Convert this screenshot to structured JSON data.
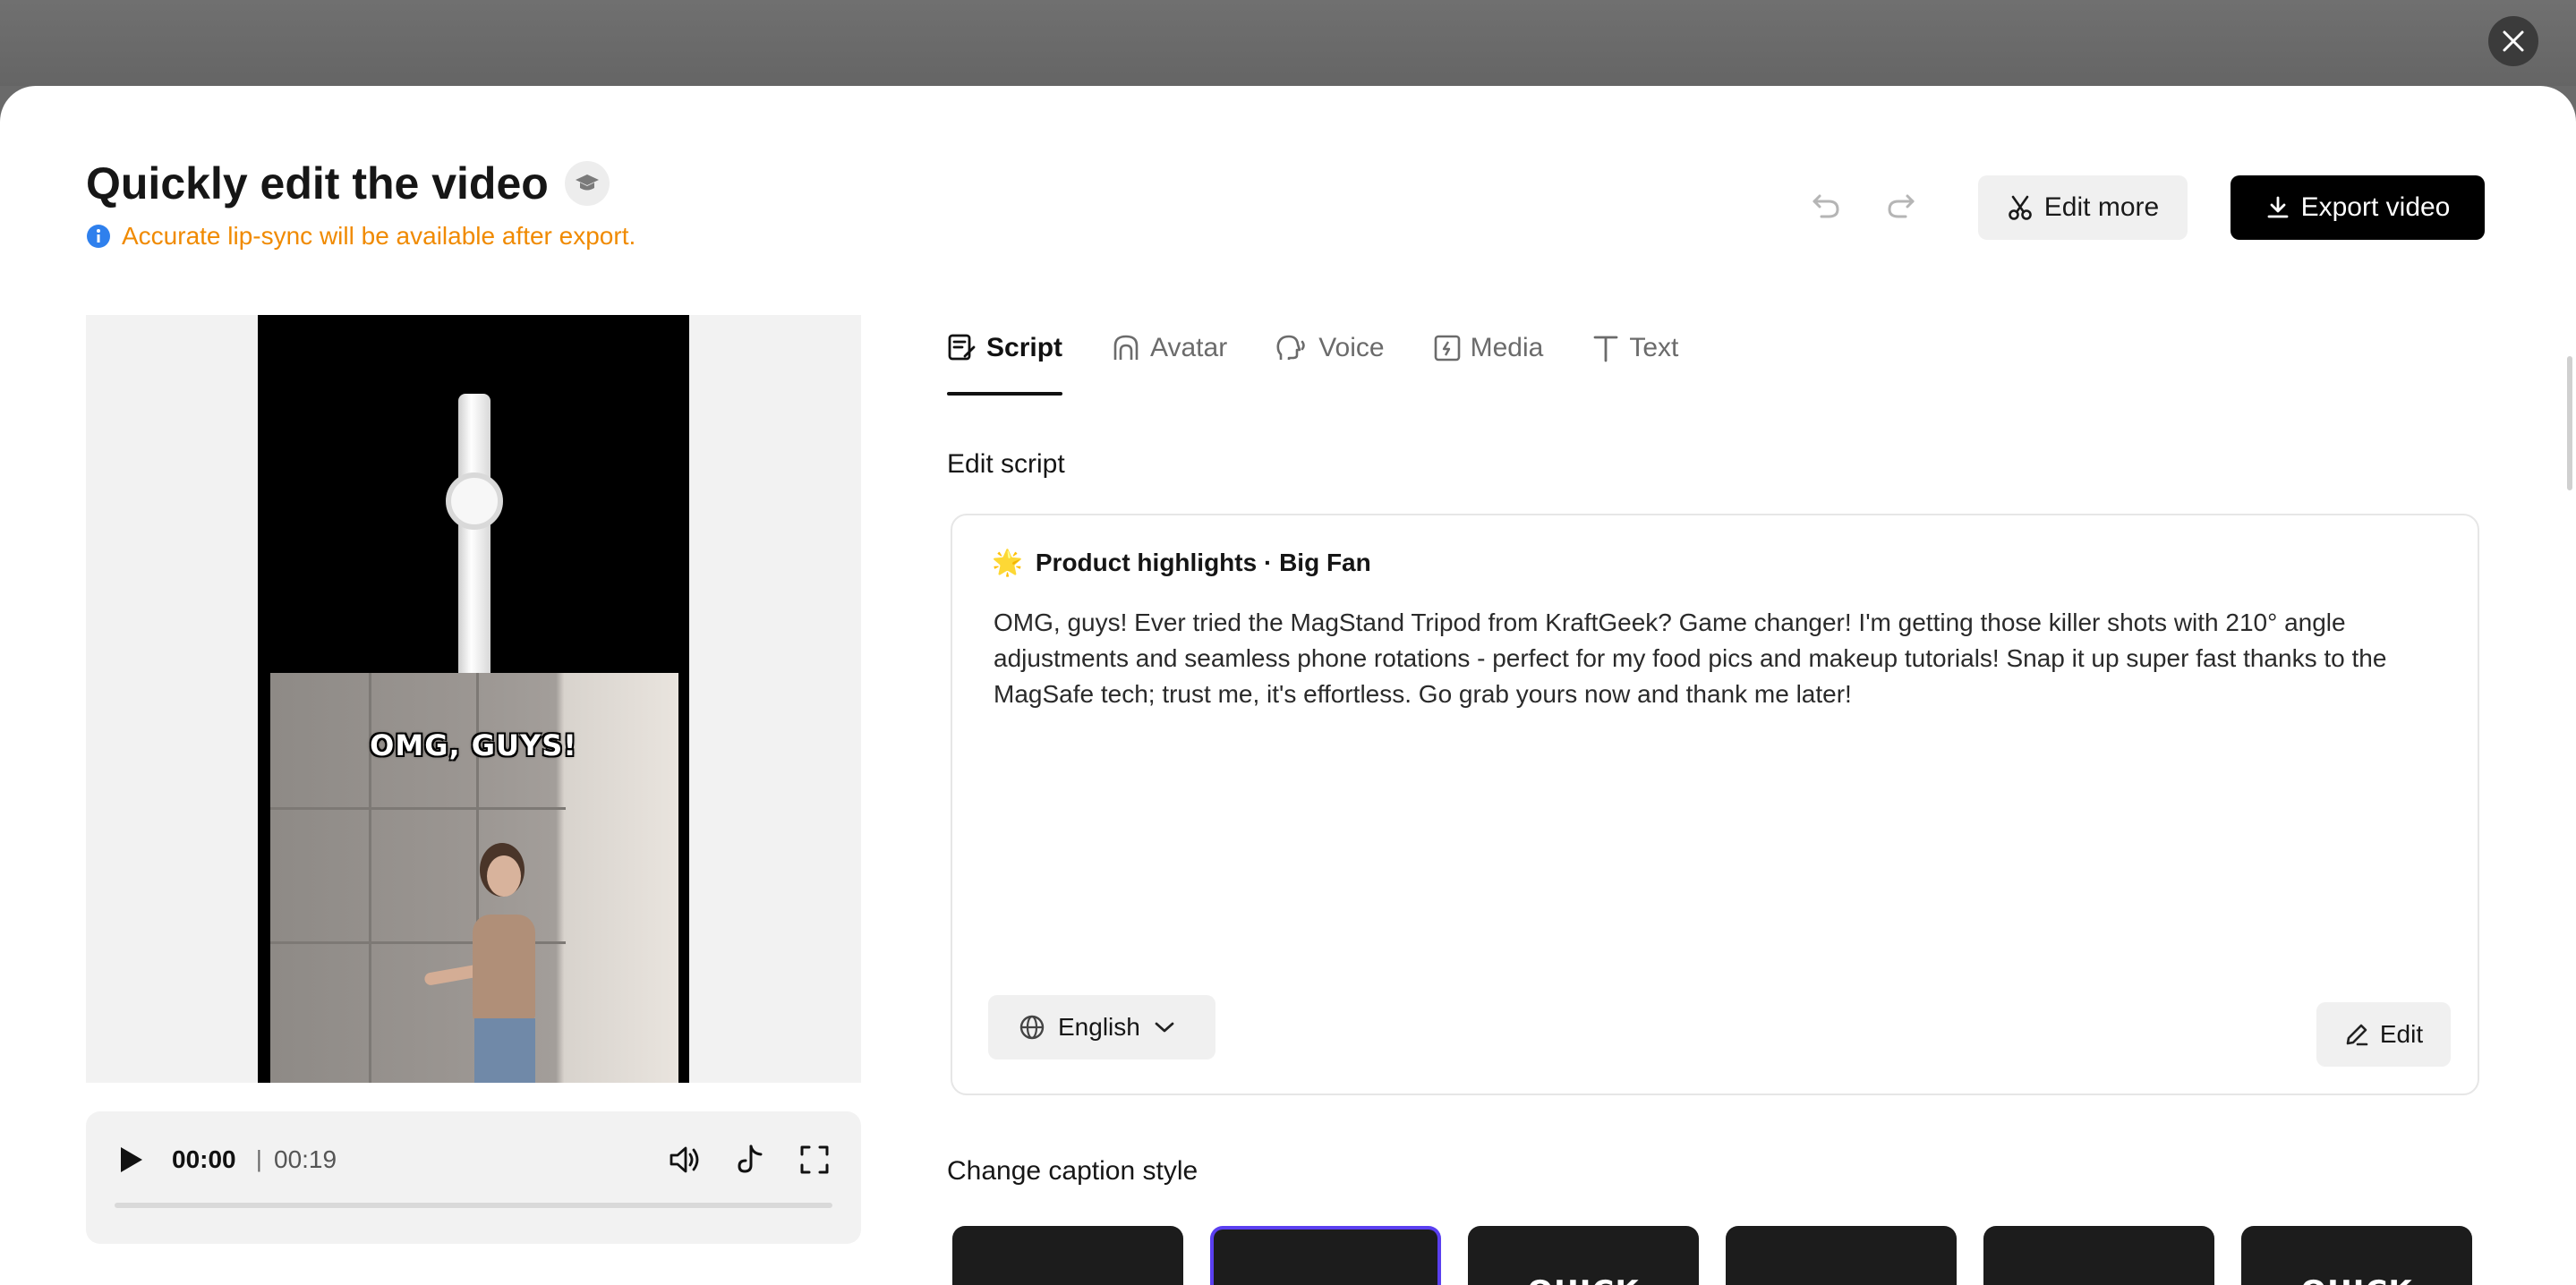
{
  "header": {
    "title": "Quickly edit the video",
    "notice": "Accurate lip-sync will be available after export.",
    "edit_more_label": "Edit more",
    "export_label": "Export video"
  },
  "preview": {
    "caption": "OMG, GUYS!",
    "time_current": "00:00",
    "time_separator": "|",
    "time_total": "00:19",
    "progress_fraction": 0
  },
  "tabs": [
    {
      "label": "Script",
      "icon": "script-icon",
      "active": true
    },
    {
      "label": "Avatar",
      "icon": "avatar-icon",
      "active": false
    },
    {
      "label": "Voice",
      "icon": "voice-icon",
      "active": false
    },
    {
      "label": "Media",
      "icon": "media-icon",
      "active": false
    },
    {
      "label": "Text",
      "icon": "text-icon",
      "active": false
    }
  ],
  "script": {
    "section_title": "Edit script",
    "heading_emoji": "🌟",
    "heading": "Product highlights · Big Fan",
    "body": "OMG, guys! Ever tried the MagStand Tripod from KraftGeek? Game changer! I'm getting those killer shots with 210° angle adjustments and seamless phone rotations - perfect for my food pics and makeup tutorials! Snap it up super fast thanks to the MagSafe tech; trust me, it's effortless. Go grab yours now and thank me later!",
    "language": "English",
    "edit_label": "Edit"
  },
  "caption_style": {
    "section_title": "Change caption style",
    "styles": [
      "",
      "",
      "QUICK",
      "",
      "",
      "QUICK"
    ],
    "selected_index": 1
  },
  "colors": {
    "notice": "#f08a00",
    "info_icon": "#2f80ed",
    "accent_selected": "#5a3ff0",
    "primary_button": "#000000"
  }
}
